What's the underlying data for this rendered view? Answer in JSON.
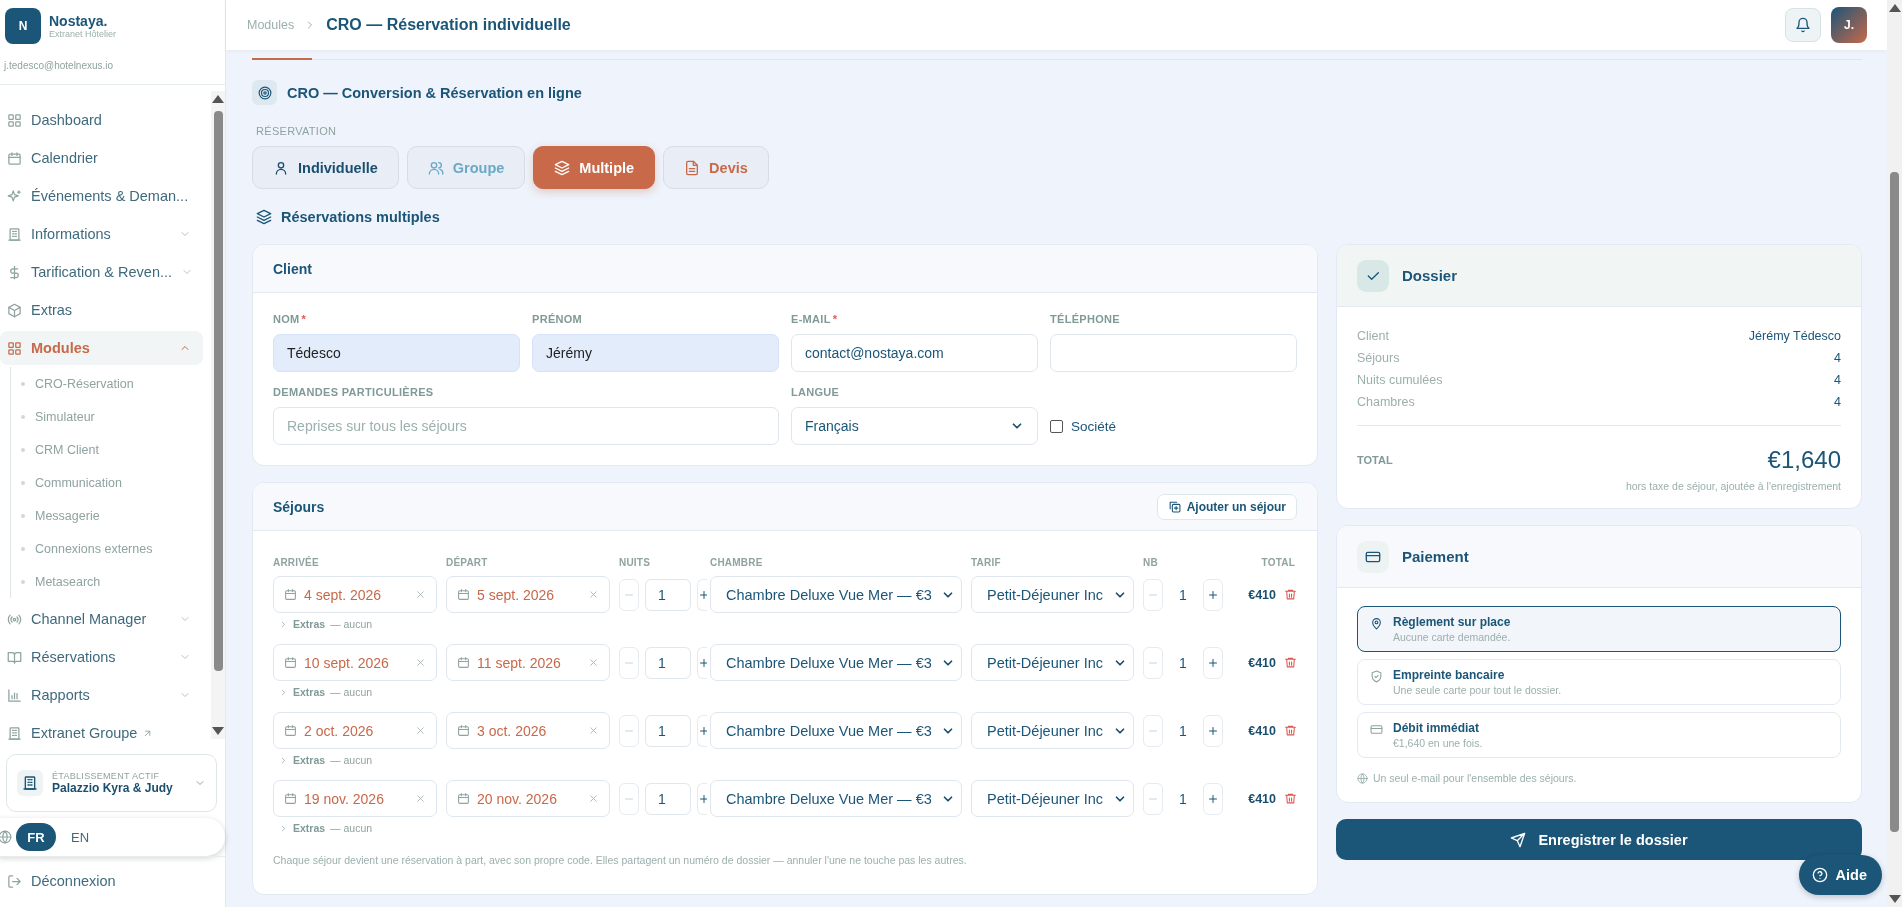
{
  "brand": {
    "logo_letter": "N",
    "name": "Nostaya.",
    "subtitle": "Extranet Hôtelier",
    "email": "j.tedesco@hotelnexus.io"
  },
  "sidebar": {
    "items": [
      {
        "label": "Dashboard",
        "kind": "link",
        "selected": false
      },
      {
        "label": "Calendrier",
        "kind": "link",
        "selected": false
      },
      {
        "label": "Événements & Deman...",
        "kind": "link",
        "selected": false
      },
      {
        "label": "Informations",
        "kind": "group",
        "selected": false,
        "expanded": false
      },
      {
        "label": "Tarification & Reven...",
        "kind": "group",
        "selected": false,
        "expanded": false
      },
      {
        "label": "Extras",
        "kind": "link",
        "selected": false
      },
      {
        "label": "Modules",
        "kind": "group",
        "selected": true,
        "expanded": true,
        "children": [
          {
            "label": "CRO-Réservation"
          },
          {
            "label": "Simulateur"
          },
          {
            "label": "CRM Client"
          },
          {
            "label": "Communication"
          },
          {
            "label": "Messagerie"
          },
          {
            "label": "Connexions externes"
          },
          {
            "label": "Metasearch"
          }
        ]
      },
      {
        "label": "Channel Manager",
        "kind": "group",
        "selected": false,
        "expanded": false
      },
      {
        "label": "Réservations",
        "kind": "group",
        "selected": false,
        "expanded": false
      },
      {
        "label": "Rapports",
        "kind": "group",
        "selected": false,
        "expanded": false
      },
      {
        "label": "Extranet Groupe",
        "kind": "external",
        "selected": false
      }
    ]
  },
  "property": {
    "label": "ÉTABLISSEMENT ACTIF",
    "name": "Palazzio Kyra & Judy"
  },
  "languages": [
    {
      "code": "FR",
      "selected": true
    },
    {
      "code": "EN",
      "selected": false
    }
  ],
  "logout": "Déconnexion",
  "header": {
    "breadcrumb": "Modules",
    "title": "CRO — Réservation individuelle",
    "avatar": "J."
  },
  "module": {
    "title": "CRO — Conversion & Réservation en ligne",
    "section_label": "RÉSERVATION",
    "subtitle": "Réservations multiples",
    "tabs": [
      {
        "label": "Individuelle",
        "selected": false,
        "color": "#1b4f6e"
      },
      {
        "label": "Groupe",
        "selected": false,
        "color": "#6aa9c6"
      },
      {
        "label": "Multiple",
        "selected": true,
        "color": "#c8694a"
      },
      {
        "label": "Devis",
        "selected": false,
        "color": "#c8694a"
      }
    ]
  },
  "client": {
    "title": "Client",
    "fields": [
      {
        "kind": "text",
        "label": "NOM",
        "required_mark": "*",
        "value": "Tédesco",
        "highlighted": true
      },
      {
        "kind": "text",
        "label": "PRÉNOM",
        "value": "Jérémy",
        "highlighted": true
      },
      {
        "kind": "text",
        "label": "E-MAIL",
        "required_mark": "*",
        "value": "contact@nostaya.com",
        "highlighted": false
      },
      {
        "kind": "text",
        "label": "TÉLÉPHONE",
        "highlighted": false
      },
      {
        "kind": "text",
        "label": "DEMANDES PARTICULIÈRES",
        "placeholder": "Reprises sur tous les séjours",
        "highlighted": false
      },
      {
        "kind": "select",
        "label": "LANGUE",
        "value": "Français"
      },
      {
        "kind": "checkbox",
        "label": "Société",
        "checked": false
      }
    ]
  },
  "stays": {
    "title": "Séjours",
    "add_button": "Ajouter un séjour",
    "columns": [
      "ARRIVÉE",
      "DÉPART",
      "NUITS",
      "CHAMBRE",
      "TARIF",
      "NB",
      "TOTAL"
    ],
    "rows": [
      {
        "arrival": "4 sept. 2026",
        "departure": "5 sept. 2026",
        "nights": "1",
        "room": "Chambre Deluxe Vue Mer — €3",
        "rate": "Petit-Déjeuner Inc",
        "count": "1",
        "total": "€410",
        "extras_label": "Extras",
        "extras_value": "— aucun"
      },
      {
        "arrival": "10 sept. 2026",
        "departure": "11 sept. 2026",
        "nights": "1",
        "room": "Chambre Deluxe Vue Mer — €3",
        "rate": "Petit-Déjeuner Inc",
        "count": "1",
        "total": "€410",
        "extras_label": "Extras",
        "extras_value": "— aucun"
      },
      {
        "arrival": "2 oct. 2026",
        "departure": "3 oct. 2026",
        "nights": "1",
        "room": "Chambre Deluxe Vue Mer — €3",
        "rate": "Petit-Déjeuner Inc",
        "count": "1",
        "total": "€410",
        "extras_label": "Extras",
        "extras_value": "— aucun"
      },
      {
        "arrival": "19 nov. 2026",
        "departure": "20 nov. 2026",
        "nights": "1",
        "room": "Chambre Deluxe Vue Mer — €3",
        "rate": "Petit-Déjeuner Inc",
        "count": "1",
        "total": "€410",
        "extras_label": "Extras",
        "extras_value": "— aucun"
      }
    ],
    "note": "Chaque séjour devient une réservation à part, avec son propre code. Elles partagent un numéro de dossier — annuler l'une ne touche pas les autres."
  },
  "dossier": {
    "title": "Dossier",
    "rows": [
      {
        "label": "Client",
        "value": "Jérémy Tédesco"
      },
      {
        "label": "Séjours",
        "value": "4"
      },
      {
        "label": "Nuits cumulées",
        "value": "4"
      },
      {
        "label": "Chambres",
        "value": "4"
      }
    ],
    "total_label": "TOTAL",
    "total": "€1,640",
    "total_note": "hors taxe de séjour, ajoutée à l'enregistrement"
  },
  "payment": {
    "title": "Paiement",
    "options": [
      {
        "title": "Règlement sur place",
        "description": "Aucune carte demandée.",
        "selected": true
      },
      {
        "title": "Empreinte bancaire",
        "description": "Une seule carte pour tout le dossier.",
        "selected": false
      },
      {
        "title": "Débit immédiat",
        "description": "€1,640 en une fois.",
        "selected": false
      }
    ],
    "note": "Un seul e-mail pour l'ensemble des séjours."
  },
  "save_button": "Enregistrer le dossier",
  "help_button": "Aide"
}
